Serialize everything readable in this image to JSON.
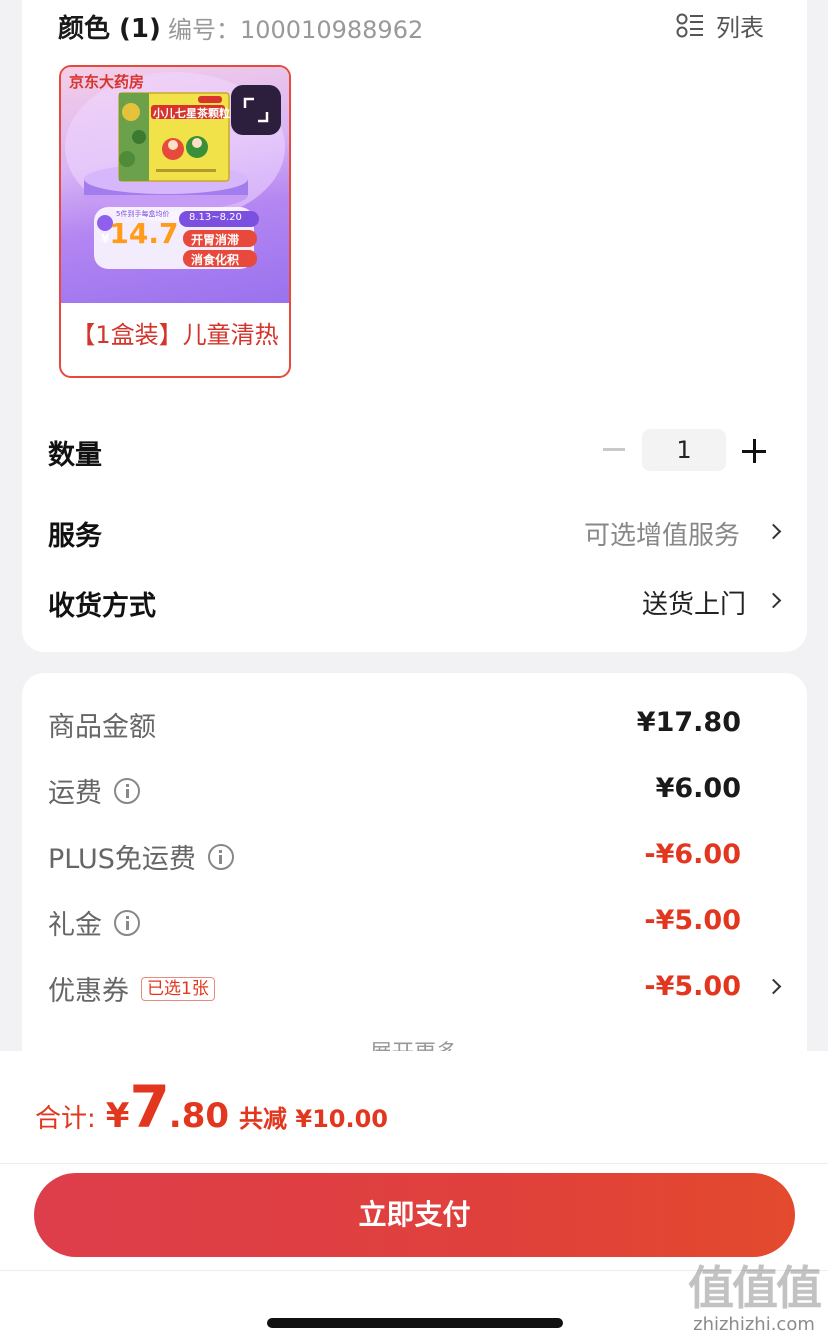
{
  "header": {
    "color_title": "颜色 (1)",
    "sku_label": "编号：100010988962",
    "list_label": "列表",
    "list_icon": "list-view-icon"
  },
  "product": {
    "store_badge": "京东大药房",
    "box_title": "小儿七星茶颗粒",
    "price_caption": "5件到手每盒均价",
    "price_currency": "¥",
    "price": "14.7",
    "date_range": "8.13~8.20",
    "tag1": "开胃消滞",
    "tag2": "消食化积",
    "name": "【1盒装】儿童清热",
    "expand_icon": "expand-icon"
  },
  "options": {
    "quantity_label": "数量",
    "quantity_value": "1",
    "service_label": "服务",
    "service_value": "可选增值服务",
    "delivery_label": "收货方式",
    "delivery_value": "送货上门"
  },
  "pricing": {
    "goods_label": "商品金额",
    "goods_amount": "¥17.80",
    "shipping_label": "运费",
    "shipping_amount": "¥6.00",
    "plus_label": "PLUS免运费",
    "plus_amount": "-¥6.00",
    "gift_label": "礼金",
    "gift_amount": "-¥5.00",
    "coupon_label": "优惠券",
    "coupon_tag": "已选1张",
    "coupon_amount": "-¥5.00",
    "expand_more": "展开更多"
  },
  "footer": {
    "total_label": "合计:",
    "currency": "¥",
    "total_int": "7",
    "total_dec": ".80",
    "reduction": "共减 ¥10.00",
    "pay_button": "立即支付"
  },
  "watermark": {
    "brand": "值值值",
    "url": "zhizhizhi.com"
  },
  "colors": {
    "accent": "#e2361f",
    "pay_button": "#e0403c",
    "product_bg": "#b486f2"
  }
}
